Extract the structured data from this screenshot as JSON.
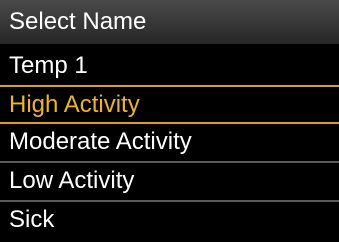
{
  "header": {
    "title": "Select Name"
  },
  "list": {
    "items": [
      {
        "label": "Temp 1",
        "selected": false
      },
      {
        "label": "High Activity",
        "selected": true
      },
      {
        "label": "Moderate Activity",
        "selected": false
      },
      {
        "label": "Low Activity",
        "selected": false
      },
      {
        "label": "Sick",
        "selected": false
      }
    ]
  },
  "colors": {
    "background": "#000000",
    "text": "#ffffff",
    "selected_text": "#f0b51d",
    "selected_border": "#d8a21e",
    "divider": "#5a5a5a"
  }
}
